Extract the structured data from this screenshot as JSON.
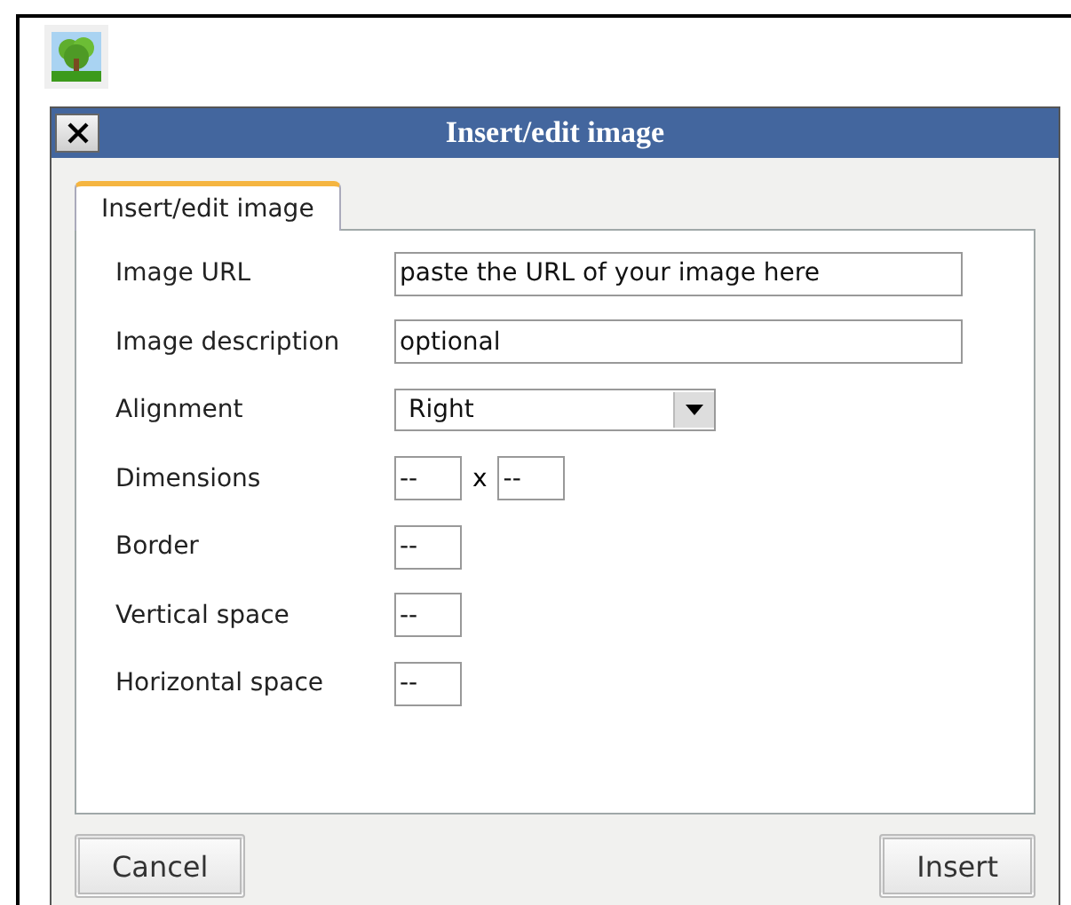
{
  "dialog": {
    "title": "Insert/edit image",
    "tabs": [
      {
        "label": "Insert/edit image",
        "selected": true
      }
    ],
    "fields": [
      {
        "kind": "text",
        "label": "Image URL",
        "value": "paste the URL of your image here"
      },
      {
        "kind": "text",
        "label": "Image description",
        "value": "optional"
      },
      {
        "kind": "select",
        "label": "Alignment",
        "value": "Right"
      },
      {
        "kind": "pair",
        "label": "Dimensions",
        "value": "--",
        "separator": "x",
        "value2": "--"
      },
      {
        "kind": "short",
        "label": "Border",
        "value": "--"
      },
      {
        "kind": "short",
        "label": "Vertical space",
        "value": "--"
      },
      {
        "kind": "short",
        "label": "Horizontal space",
        "value": "--"
      }
    ],
    "buttons": [
      "Cancel",
      "Insert"
    ]
  }
}
